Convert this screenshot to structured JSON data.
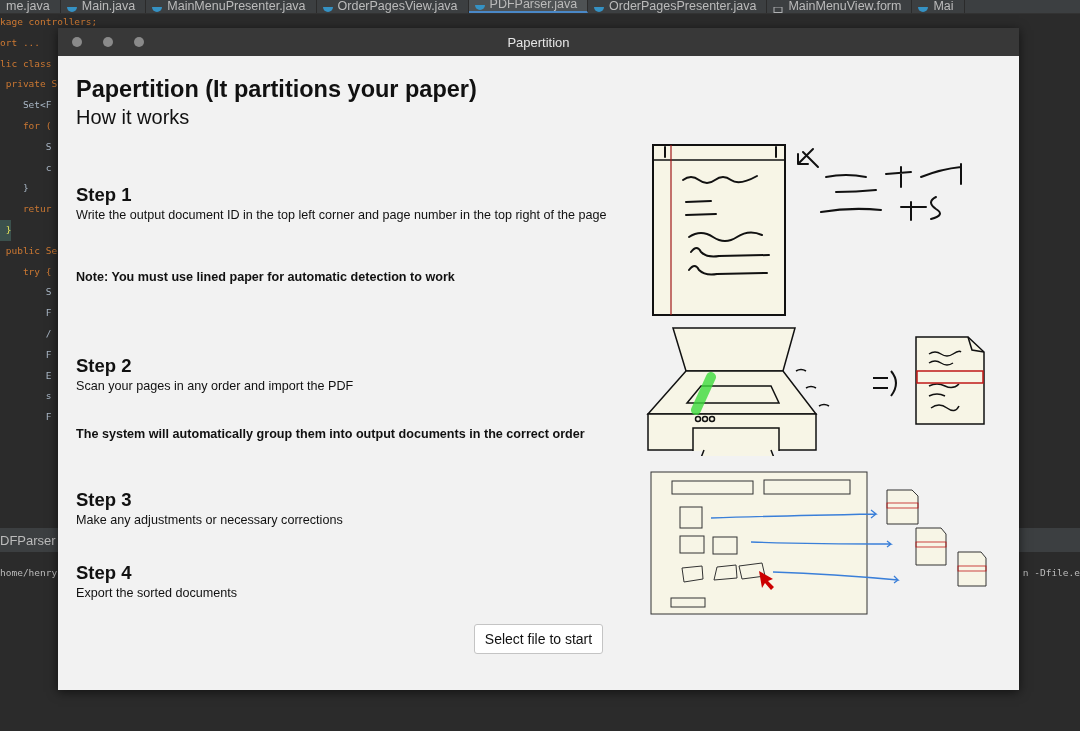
{
  "ide": {
    "tabs": [
      {
        "label": "me.java",
        "kind": "class",
        "selected": false
      },
      {
        "label": "Main.java",
        "kind": "class",
        "selected": false
      },
      {
        "label": "MainMenuPresenter.java",
        "kind": "class",
        "selected": false
      },
      {
        "label": "OrderPagesView.java",
        "kind": "class",
        "selected": false
      },
      {
        "label": "PDFParser.java",
        "kind": "class",
        "selected": true
      },
      {
        "label": "OrderPagesPresenter.java",
        "kind": "class",
        "selected": false
      },
      {
        "label": "MainMenuView.form",
        "kind": "form",
        "selected": false
      },
      {
        "label": "Mai",
        "kind": "class",
        "selected": false
      }
    ],
    "code_lines": [
      {
        "text": "kage controllers;",
        "kind": "keyword"
      },
      {
        "text": "ort ...",
        "kind": "keyword"
      },
      {
        "text": "lic class",
        "kind": "keyword"
      },
      {
        "text": " private S",
        "kind": "keyword"
      },
      {
        "text": "    Set<F",
        "kind": "plain"
      },
      {
        "text": "    for (",
        "kind": "keyword"
      },
      {
        "text": "        S",
        "kind": "plain"
      },
      {
        "text": "        c",
        "kind": "plain"
      },
      {
        "text": "    }",
        "kind": "plain"
      },
      {
        "text": "    retur",
        "kind": "keyword"
      },
      {
        "text": " }",
        "kind": "brace"
      },
      {
        "text": " public Se",
        "kind": "keyword"
      },
      {
        "text": "    try {",
        "kind": "keyword"
      },
      {
        "text": "        S",
        "kind": "plain"
      },
      {
        "text": "        F",
        "kind": "plain"
      },
      {
        "text": "        /",
        "kind": "plain"
      },
      {
        "text": "        F",
        "kind": "plain"
      },
      {
        "text": "        E",
        "kind": "plain"
      },
      {
        "text": "        s",
        "kind": "plain"
      },
      {
        "text": "        F",
        "kind": "plain"
      }
    ],
    "panel_tab": "DFParser",
    "terminal_left": "home/henry",
    "terminal_right": "n -Dfile.e"
  },
  "dialog": {
    "title": "Papertition",
    "heading": "Papertition (It partitions your paper)",
    "subheading": "How it works",
    "sections": [
      {
        "steps": [
          {
            "title": "Step 1",
            "text": "Write the output document ID in the top left corner and page number in the top right of the page"
          }
        ],
        "note": "Note: You must use lined paper for automatic detection to work"
      },
      {
        "steps": [
          {
            "title": "Step 2",
            "text": "Scan your pages in any order and import the PDF"
          }
        ],
        "note": "The system will automatically group them into output documents in the correct order"
      },
      {
        "steps": [
          {
            "title": "Step 3",
            "text": "Make any adjustments or necessary corrections"
          },
          {
            "title": "Step 4",
            "text": "Export the sorted documents"
          }
        ]
      }
    ],
    "button": "Select file to start"
  }
}
